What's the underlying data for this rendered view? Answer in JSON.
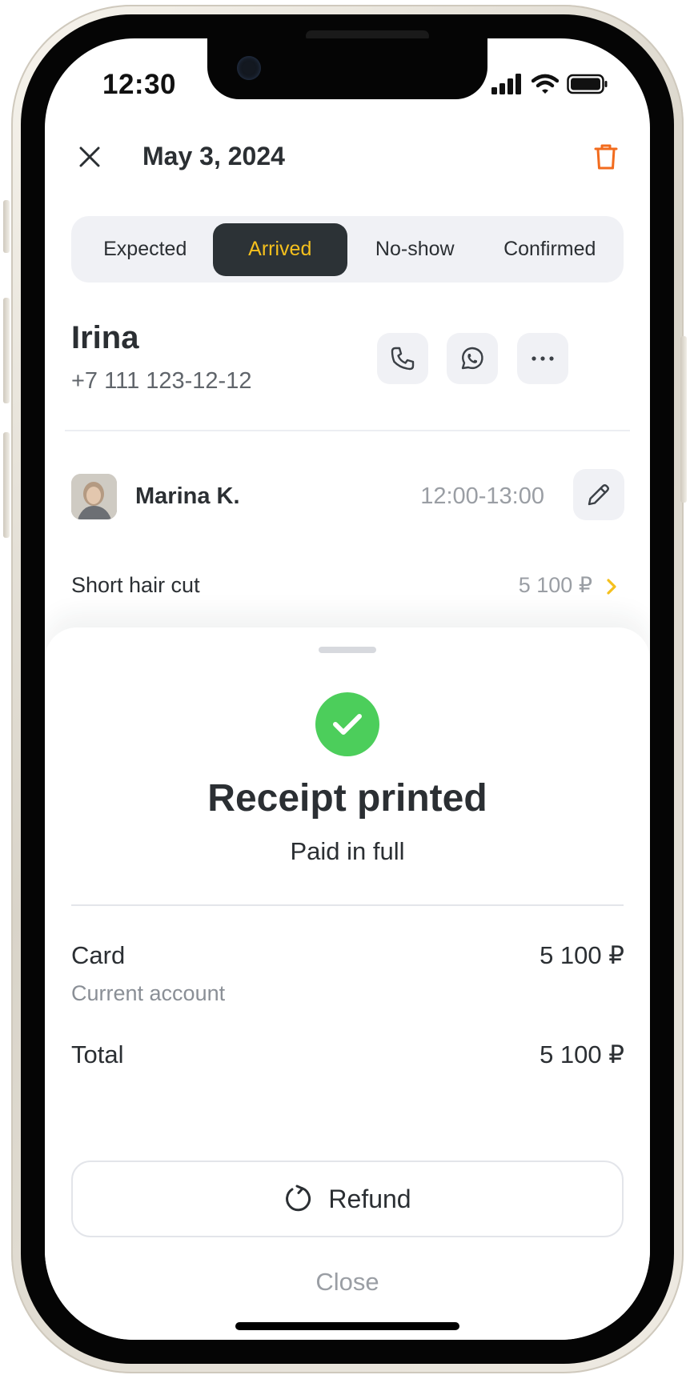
{
  "status_bar": {
    "time": "12:30"
  },
  "header": {
    "date": "May 3, 2024"
  },
  "tabs": [
    {
      "label": "Expected",
      "active": false
    },
    {
      "label": "Arrived",
      "active": true
    },
    {
      "label": "No-show",
      "active": false
    },
    {
      "label": "Confirmed",
      "active": false
    }
  ],
  "client": {
    "name": "Irina",
    "phone": "+7 111 123-12-12"
  },
  "appointment": {
    "staff_name": "Marina K.",
    "time_range": "12:00-13:00"
  },
  "service": {
    "name": "Short hair cut",
    "price": "5 100 ₽"
  },
  "sheet": {
    "title": "Receipt printed",
    "subtitle": "Paid in full",
    "payment_method": "Card",
    "payment_amount": "5 100 ₽",
    "payment_account": "Current account",
    "total_label": "Total",
    "total_amount": "5 100 ₽",
    "refund_label": "Refund",
    "close_label": "Close"
  },
  "colors": {
    "accent_yellow": "#f5c01d",
    "delete_orange": "#f26b1d",
    "success_green": "#4cce5b",
    "dark_tab": "#2c3236"
  }
}
